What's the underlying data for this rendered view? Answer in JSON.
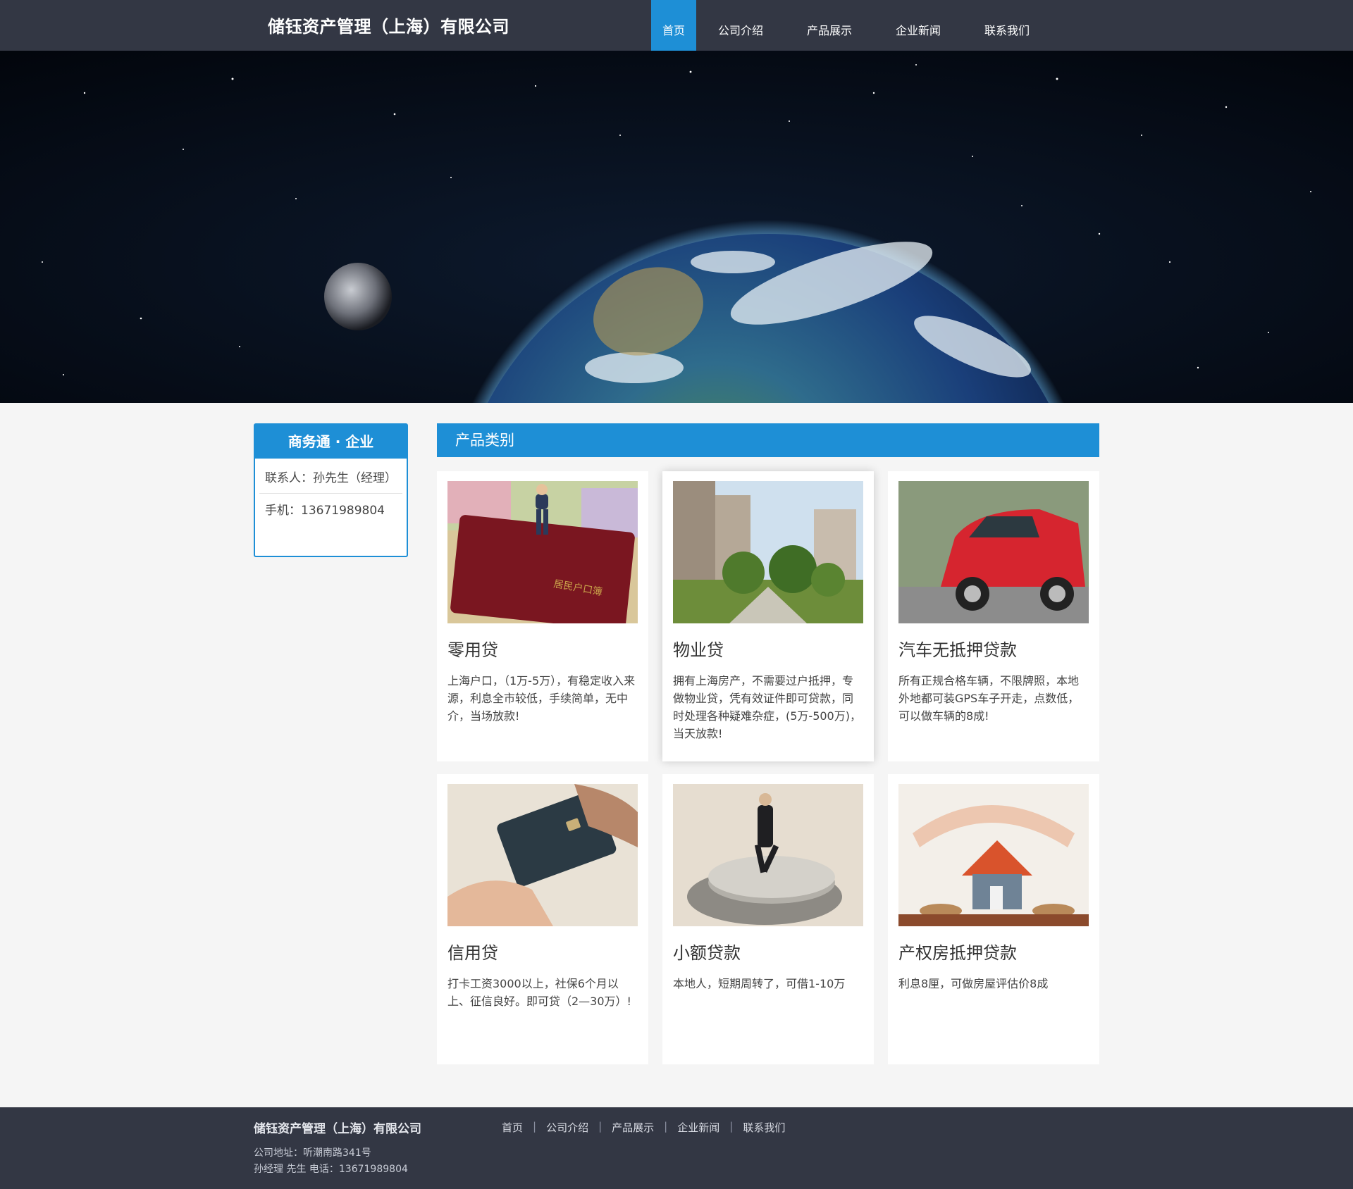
{
  "header": {
    "company": "储钰资产管理（上海）有限公司",
    "nav": [
      "首页",
      "公司介绍",
      "产品展示",
      "企业新闻",
      "联系我们"
    ],
    "active_index": 0
  },
  "sidebar": {
    "title": "商务通 · 企业",
    "contact": "联系人：孙先生（经理）",
    "phone": "手机：13671989804"
  },
  "category": {
    "title": "产品类别",
    "products": [
      {
        "title": "零用贷",
        "desc": "上海户口，（1万-5万），有稳定收入来源，利息全市较低，手续简单，无中介，当场放款!",
        "image": "household-register-photo"
      },
      {
        "title": "物业贷",
        "desc": "拥有上海房产，不需要过户抵押，专做物业贷，凭有效证件即可贷款，同时处理各种疑难杂症，(5万-500万)，当天放款!",
        "image": "residential-buildings-photo"
      },
      {
        "title": "汽车无抵押贷款",
        "desc": "所有正规合格车辆，不限牌照，本地外地都可装GPS车子开走，点数低，可以做车辆的8成!",
        "image": "red-car-photo"
      },
      {
        "title": "信用贷",
        "desc": "打卡工资3000以上，社保6个月以上、征信良好。即可贷（2—30万）!",
        "image": "credit-card-photo"
      },
      {
        "title": "小额贷款",
        "desc": "本地人，短期周转了，可借1-10万",
        "image": "coins-figure-photo"
      },
      {
        "title": "产权房抵押贷款",
        "desc": "利息8厘，可做房屋评估价8成",
        "image": "house-in-hands-photo"
      }
    ]
  },
  "footer": {
    "company": "储钰资产管理（上海）有限公司",
    "links": [
      "首页",
      "公司介绍",
      "产品展示",
      "企业新闻",
      "联系我们"
    ],
    "address": "公司地址：听潮南路341号",
    "contact": "孙经理 先生   电话：13671989804"
  }
}
